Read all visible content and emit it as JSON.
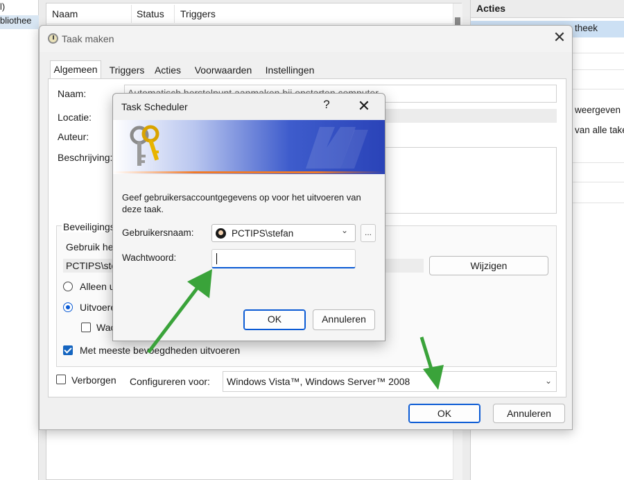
{
  "background": {
    "left_pane": {
      "item1": "l)",
      "item2": "bliothee"
    },
    "list_columns": [
      "Naam",
      "Status",
      "Triggers"
    ],
    "actions_pane": {
      "header": "Acties",
      "items": [
        "theek",
        "weergeven",
        "van alle take"
      ]
    }
  },
  "taak_maken": {
    "title": "Taak maken",
    "tabs": [
      "Algemeen",
      "Triggers",
      "Acties",
      "Voorwaarden",
      "Instellingen"
    ],
    "active_tab": "Algemeen",
    "naam_label": "Naam:",
    "naam_value": "Automatisch herstelpunt aanmaken bij opstarten computer",
    "locatie_label": "Locatie:",
    "auteur_label": "Auteur:",
    "beschrijving_label": "Beschrijving:",
    "security": {
      "legend": "Beveiligings",
      "use_account_label": "Gebruik he",
      "account_value": "PCTIPS\\ste",
      "change_button": "Wijzigen",
      "radio_only_logged_on": "Alleen u",
      "radio_run_whether": "Uitvoere",
      "checkbox_no_store": "Wac",
      "checkbox_highest": "Met meeste bevoegdheden uitvoeren",
      "highest_checked": true
    },
    "hidden_label": "Verborgen",
    "configure_label": "Configureren voor:",
    "configure_value": "Windows Vista™, Windows Server™ 2008",
    "ok_button": "OK",
    "cancel_button": "Annuleren"
  },
  "task_scheduler": {
    "title": "Task Scheduler",
    "help_glyph": "?",
    "close_glyph": "✕",
    "description": "Geef gebruikersaccountgegevens op voor het uitvoeren van deze taak.",
    "username_label": "Gebruikersnaam:",
    "username_value": "PCTIPS\\stefan",
    "browse_label": "...",
    "password_label": "Wachtwoord:",
    "password_value": "",
    "ok_button": "OK",
    "cancel_button": "Annuleren"
  },
  "colors": {
    "accent": "#0a5ad4",
    "arrow": "#3aa33a",
    "banner_orange": "#f07a28",
    "banner_blue": "#2a43b8"
  },
  "icons": [
    "clock-icon",
    "close-icon",
    "keys-icon",
    "user-avatar-icon",
    "chevron-down-icon",
    "help-icon"
  ]
}
